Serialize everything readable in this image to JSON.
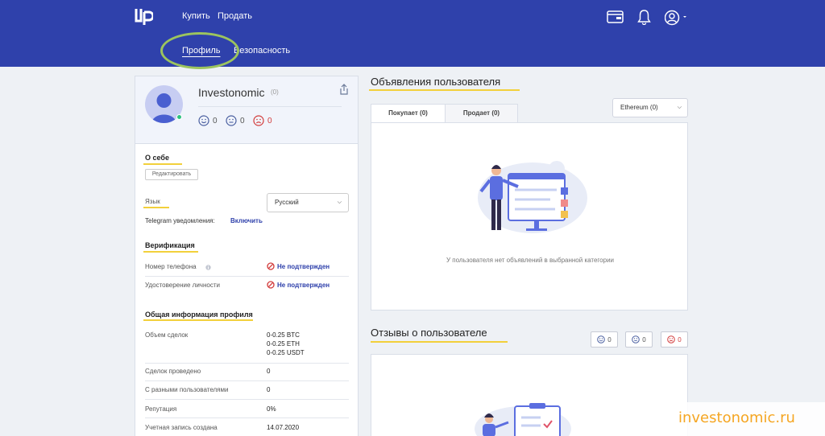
{
  "header": {
    "nav": [
      "Купить",
      "Продать"
    ],
    "sub_nav": [
      "Профиль",
      "Безопасность"
    ],
    "brand_color": "#2f41ab"
  },
  "profile": {
    "username": "Investonomic",
    "count": "(0)",
    "ratings": {
      "positive": "0",
      "neutral": "0",
      "negative": "0"
    }
  },
  "about": {
    "title": "О себе",
    "edit_label": "Редактировать",
    "language_label": "Язык",
    "language_value": "Русский",
    "telegram_label": "Telegram уведомления:",
    "telegram_action": "Включить"
  },
  "verification": {
    "title": "Верификация",
    "phone_label": "Номер телефона",
    "phone_status": "Не подтвержден",
    "id_label": "Удостоверение личности",
    "id_status": "Не подтвержден"
  },
  "general": {
    "title": "Общая информация профиля",
    "volume_label": "Объем сделок",
    "volume_lines": [
      "0-0.25 BTC",
      "0-0.25 ETH",
      "0-0.25 USDT"
    ],
    "deals_label": "Сделок проведено",
    "deals_value": "0",
    "partners_label": "С разными пользователями",
    "partners_value": "0",
    "reputation_label": "Репутация",
    "reputation_value": "0%",
    "created_label": "Учетная запись создана",
    "created_value": "14.07.2020"
  },
  "ads": {
    "title": "Объявления пользователя",
    "tabs": [
      "Покупает (0)",
      "Продает (0)"
    ],
    "crypto_select": "Ethereum (0)",
    "empty_message": "У пользователя нет объявлений в выбранной категории"
  },
  "reviews": {
    "title": "Отзывы о пользователе",
    "positive": "0",
    "neutral": "0",
    "negative": "0"
  },
  "watermark": "investonomic.ru"
}
